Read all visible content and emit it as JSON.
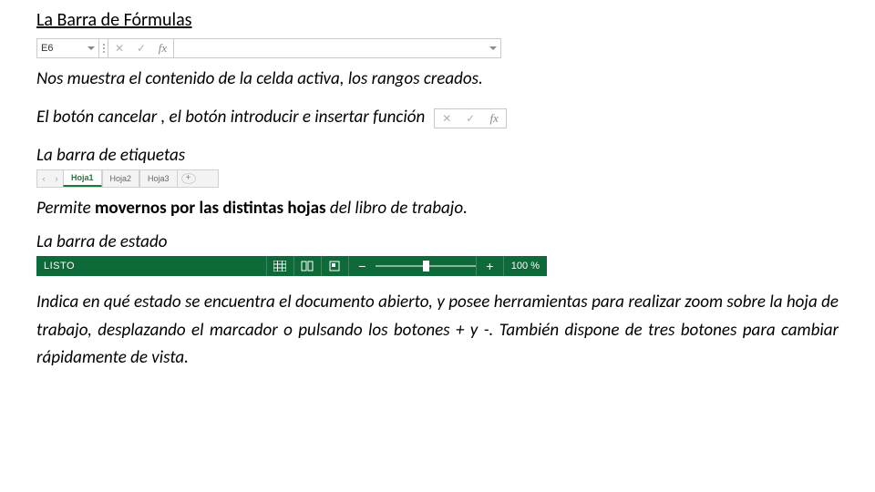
{
  "title_prefix": "La  Barra ",
  "title_de": "de ",
  "title_formulas": "Fórmulas",
  "formula_bar": {
    "name_box": "E6",
    "cancel_glyph": "✕",
    "enter_glyph": "✓",
    "fx_glyph": "fx",
    "formula_value": ""
  },
  "p1": "Nos muestra el contenido de la celda activa, los rangos creados.",
  "p2": "El botón cancelar , el botón introducir e insertar función",
  "h2": "La barra de etiquetas",
  "sheet_tabs": {
    "prev": "‹",
    "next": "›",
    "tab1": "Hoja1",
    "tab2": "Hoja2",
    "tab3": "Hoja3",
    "add": "+"
  },
  "p3_pre": "Permite ",
  "p3_bold": "movernos por las distintas hojas",
  "p3_post": " del libro de trabajo.",
  "h3": "La barra de estado",
  "status": {
    "label": "LISTO",
    "minus": "−",
    "plus": "+",
    "zoom": "100 %"
  },
  "p4": "Indica en qué estado se encuentra el documento abierto, y posee herramientas para realizar zoom sobre la hoja de trabajo, desplazando el marcador o pulsando los botones + y -. También dispone de tres botones para cambiar rápidamente de vista."
}
